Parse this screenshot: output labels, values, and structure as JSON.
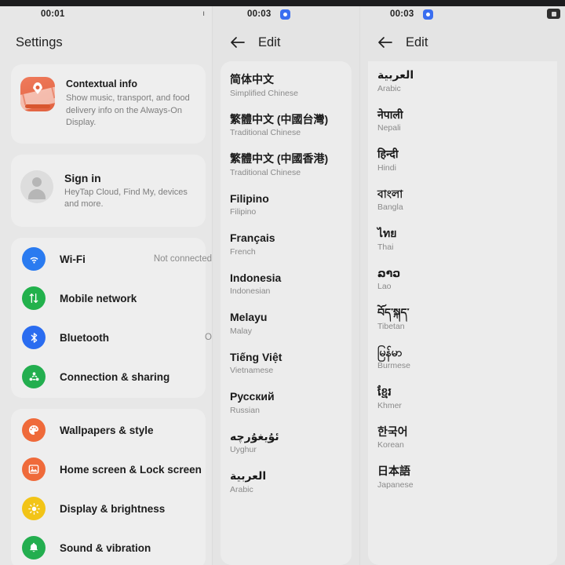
{
  "window": {
    "top_bezel_color": "#1c1c1e",
    "background_color": "#e8e8e8"
  },
  "panels": {
    "left": {
      "statusbar": {
        "clock": "00:01",
        "right_tick": "ı"
      },
      "header": {
        "title": "Settings"
      },
      "cards": {
        "contextual": {
          "icon": "contextual-info-icon",
          "title": "Contextual info",
          "subtitle": "Show music, transport, and food delivery info on the Always-On Display."
        },
        "signin": {
          "icon": "avatar-icon",
          "title": "Sign in",
          "subtitle": "HeyTap Cloud, Find My, devices and more."
        },
        "connectivity_rows": [
          {
            "icon": "wifi-icon",
            "label": "Wi-Fi",
            "value": "Not connected",
            "color": "#2a7bf0"
          },
          {
            "icon": "mobile-network-icon",
            "label": "Mobile network",
            "value": "",
            "color": "#22b14c"
          },
          {
            "icon": "bluetooth-icon",
            "label": "Bluetooth",
            "value": "O",
            "color": "#2a6cf0"
          },
          {
            "icon": "connection-sharing-icon",
            "label": "Connection & sharing",
            "value": "",
            "color": "#23ae4f"
          }
        ],
        "personalization_rows": [
          {
            "icon": "palette-icon",
            "label": "Wallpapers & style",
            "value": "",
            "color": "#ef6a3a"
          },
          {
            "icon": "home-lock-icon",
            "label": "Home screen & Lock screen",
            "value": "",
            "color": "#ef6a3a"
          },
          {
            "icon": "brightness-icon",
            "label": "Display & brightness",
            "value": "",
            "color": "#f2c417"
          },
          {
            "icon": "bell-icon",
            "label": "Sound & vibration",
            "value": "",
            "color": "#23ae4f"
          }
        ]
      }
    },
    "middle": {
      "statusbar": {
        "clock": "00:03",
        "badge": "blue-record-badge"
      },
      "header": {
        "back": "back-arrow-icon",
        "title": "Edit"
      },
      "languages": [
        {
          "native": "简体中文",
          "english": "Simplified Chinese",
          "rtl": false
        },
        {
          "native": "繁體中文 (中國台灣)",
          "english": "Traditional Chinese",
          "rtl": false
        },
        {
          "native": "繁體中文 (中國香港)",
          "english": "Traditional Chinese",
          "rtl": false
        },
        {
          "native": "Filipino",
          "english": "Filipino",
          "rtl": false
        },
        {
          "native": "Français",
          "english": "French",
          "rtl": false
        },
        {
          "native": "Indonesia",
          "english": "Indonesian",
          "rtl": false
        },
        {
          "native": "Melayu",
          "english": "Malay",
          "rtl": false
        },
        {
          "native": "Tiếng Việt",
          "english": "Vietnamese",
          "rtl": false
        },
        {
          "native": "Русский",
          "english": "Russian",
          "rtl": false
        },
        {
          "native": "ئۇيغۇرچە",
          "english": "Uyghur",
          "rtl": true
        },
        {
          "native": "العربية",
          "english": "Arabic",
          "rtl": true
        }
      ]
    },
    "right": {
      "statusbar": {
        "clock": "00:03",
        "badge": "blue-record-badge",
        "corner_chip": "dark-chip-icon"
      },
      "header": {
        "back": "back-arrow-icon",
        "title": "Edit"
      },
      "languages": [
        {
          "native": "العربية",
          "english": "Arabic",
          "rtl": true
        },
        {
          "native": "नेपाली",
          "english": "Nepali",
          "rtl": false
        },
        {
          "native": "हिन्दी",
          "english": "Hindi",
          "rtl": false
        },
        {
          "native": "বাংলা",
          "english": "Bangla",
          "rtl": false
        },
        {
          "native": "ไทย",
          "english": "Thai",
          "rtl": false
        },
        {
          "native": "ລາວ",
          "english": "Lao",
          "rtl": false
        },
        {
          "native": "བོད་སྐད་",
          "english": "Tibetan",
          "rtl": false
        },
        {
          "native": "မြန်မာ",
          "english": "Burmese",
          "rtl": false
        },
        {
          "native": "ខ្មែរ",
          "english": "Khmer",
          "rtl": false
        },
        {
          "native": "한국어",
          "english": "Korean",
          "rtl": false
        },
        {
          "native": "日本語",
          "english": "Japanese",
          "rtl": false
        }
      ]
    }
  }
}
